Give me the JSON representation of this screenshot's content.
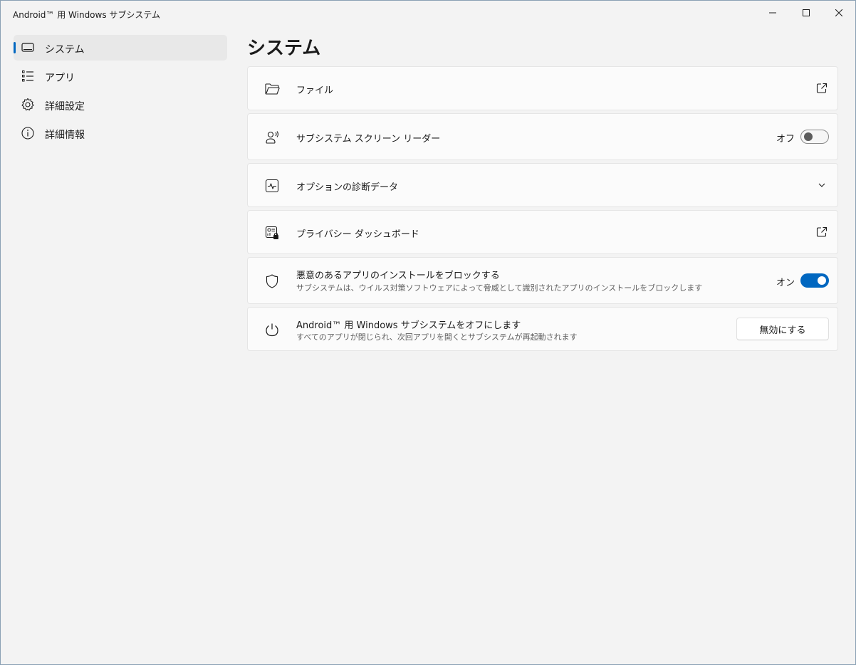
{
  "window": {
    "title": "Android™ 用 Windows サブシステム"
  },
  "sidebar": {
    "items": [
      {
        "label": "システム",
        "icon": "monitor-icon",
        "selected": true
      },
      {
        "label": "アプリ",
        "icon": "list-icon",
        "selected": false
      },
      {
        "label": "詳細設定",
        "icon": "gear-icon",
        "selected": false
      },
      {
        "label": "詳細情報",
        "icon": "info-icon",
        "selected": false
      }
    ]
  },
  "main": {
    "title": "システム",
    "settings": [
      {
        "title": "ファイル",
        "icon": "folder-icon",
        "action": "open-external-icon"
      },
      {
        "title": "サブシステム スクリーン リーダー",
        "icon": "screen-reader-icon",
        "state_label": "オフ",
        "toggle": false
      },
      {
        "title": "オプションの診断データ",
        "icon": "diagnostics-icon",
        "action": "chevron-down-icon"
      },
      {
        "title": "プライバシー ダッシュボード",
        "icon": "privacy-dashboard-icon",
        "action": "open-external-icon"
      },
      {
        "title": "悪意のあるアプリのインストールをブロックする",
        "subtitle": "サブシステムは、ウイルス対策ソフトウェアによって脅威として識別されたアプリのインストールをブロックします",
        "icon": "shield-icon",
        "state_label": "オン",
        "toggle": true
      },
      {
        "title": "Android™ 用 Windows サブシステムをオフにします",
        "subtitle": "すべてのアプリが閉じられ、次回アプリを開くとサブシステムが再起動されます",
        "icon": "power-icon",
        "button_label": "無効にする"
      }
    ]
  },
  "colors": {
    "accent": "#0067c0",
    "background": "#f3f3f3",
    "card": "#fbfbfb"
  }
}
